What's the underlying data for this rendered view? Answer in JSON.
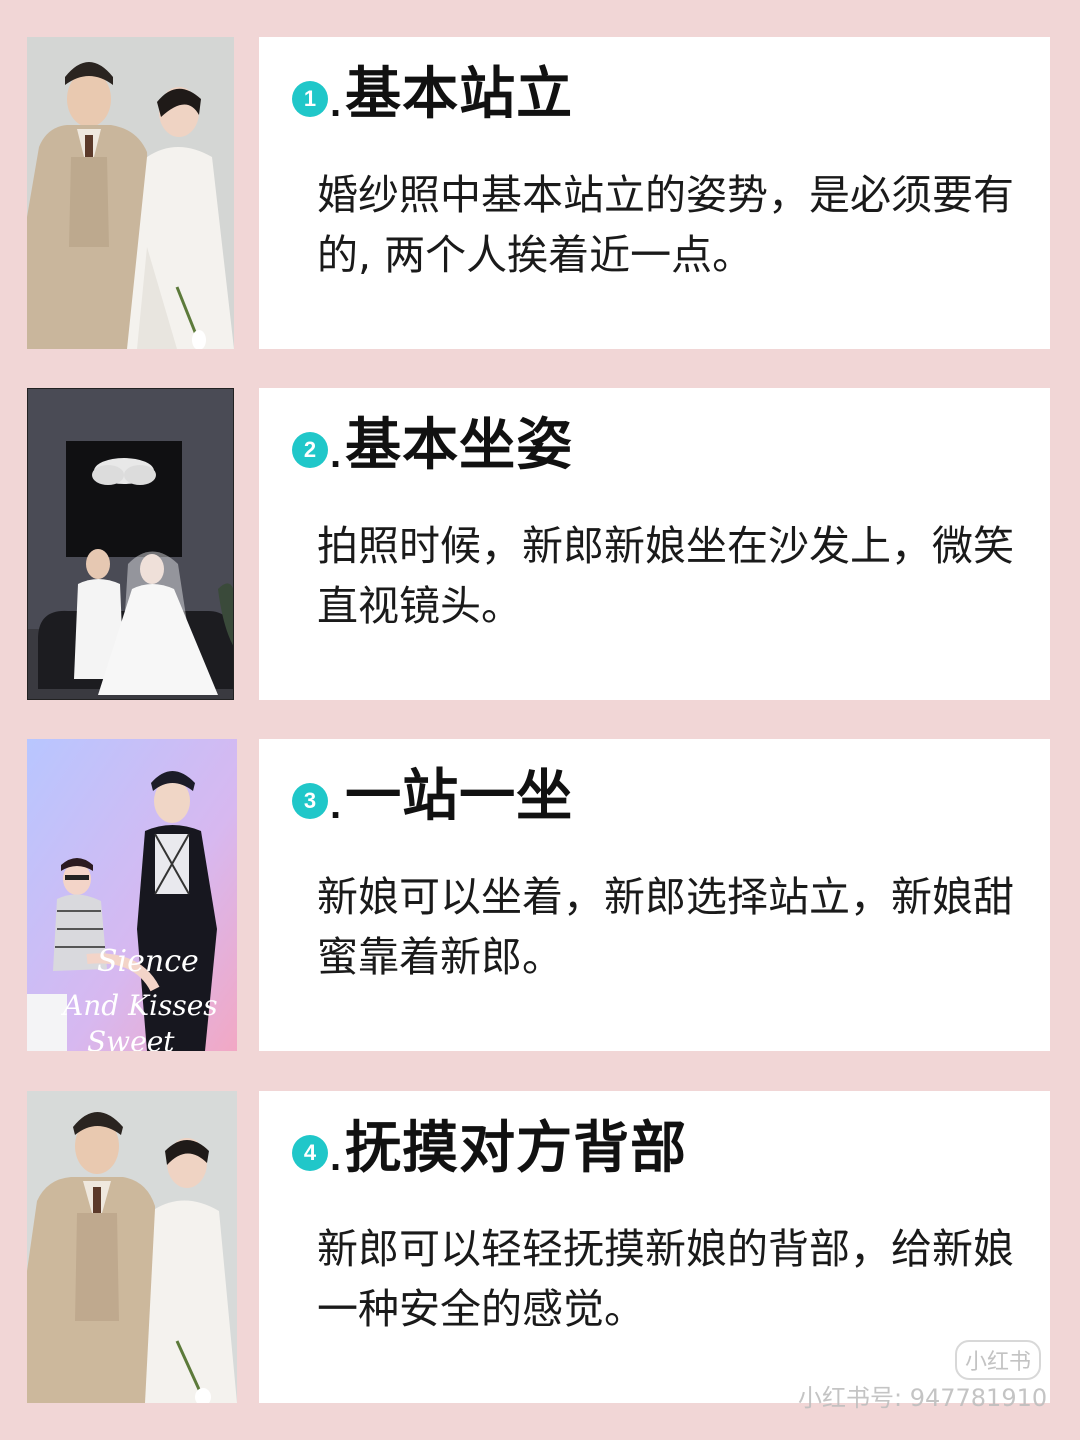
{
  "items": [
    {
      "num": "1",
      "dot": ".",
      "title": "基本站立",
      "desc": "婚纱照中基本站立的姿势，是必须要有的, 两个人挨着近一点。"
    },
    {
      "num": "2",
      "dot": ".",
      "title": "基本坐姿",
      "desc": "拍照时候，新郎新娘坐在沙发上，微笑直视镜头。"
    },
    {
      "num": "3",
      "dot": ".",
      "title": "一站一坐",
      "desc": "新娘可以坐着，新郎选择站立，新娘甜蜜靠着新郎。"
    },
    {
      "num": "4",
      "dot": ".",
      "title": "抚摸对方背部",
      "desc": "新郎可以轻轻抚摸新娘的背部，给新娘一种安全的感觉。"
    }
  ],
  "photo3_text": "Sience And Kisses Sweet",
  "watermark": {
    "logo": "小红书",
    "id": "小红书号: 947781910"
  },
  "colors": {
    "background": "#f1d6d6",
    "accent": "#20c7c9",
    "card": "#ffffff"
  }
}
